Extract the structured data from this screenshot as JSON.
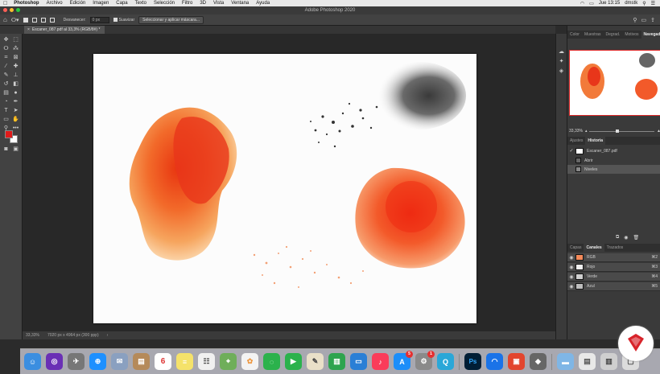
{
  "menubar": {
    "app": "Photoshop",
    "items": [
      "Archivo",
      "Edición",
      "Imagen",
      "Capa",
      "Texto",
      "Selección",
      "Filtro",
      "3D",
      "Vista",
      "Ventana",
      "Ayuda"
    ],
    "clock": "Jue 13:15",
    "user": "dmstk"
  },
  "window": {
    "title": "Adobe Photoshop 2020"
  },
  "options": {
    "feather_label": "Desvanecer:",
    "feather_value": "0 px",
    "antialias_label": "Suavizar",
    "select_mask_button": "Seleccionar y aplicar máscara..."
  },
  "document": {
    "tab_label": "Escaner_087.pdf al 33,3% (RGB/8#) *"
  },
  "status": {
    "zoom": "33,33%",
    "doc_size": "7020 px x 4964 px (300 ppp)"
  },
  "panels": {
    "top_tabs": [
      "Color",
      "Muestras",
      "Degrad.",
      "Motivos",
      "Navegador"
    ],
    "top_active": "Navegador",
    "navigator_zoom": "33,33%",
    "history_tabs": [
      "Ajustes",
      "Historia"
    ],
    "history_active": "Historia",
    "history_snapshot": "Escaner_087.pdf",
    "history_items": [
      "Abrir",
      "Niveles"
    ],
    "channels_tabs": [
      "Capas",
      "Canales",
      "Trazados"
    ],
    "channels_active": "Canales",
    "channels": [
      {
        "name": "RGB",
        "shortcut": "⌘2"
      },
      {
        "name": "Rojo",
        "shortcut": "⌘3"
      },
      {
        "name": "Verde",
        "shortcut": "⌘4"
      },
      {
        "name": "Azul",
        "shortcut": "⌘5"
      }
    ]
  },
  "dock": {
    "calendar_day": "6",
    "appstore_badge": "5",
    "prefs_badge": "1",
    "ps_label": "Ps"
  },
  "colors": {
    "foreground": "#e01a1a",
    "background": "#ffffff",
    "accent_orange": "#f15a24",
    "navigator_frame": "#e02828",
    "logo_red": "#d8232a"
  }
}
